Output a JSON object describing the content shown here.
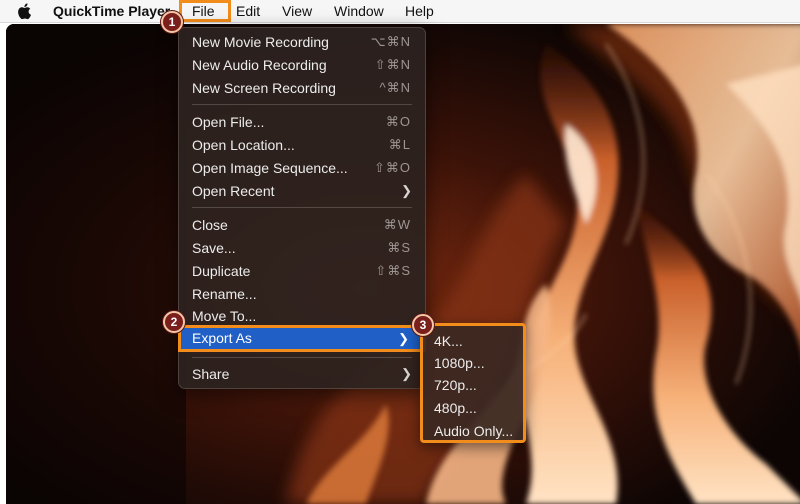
{
  "menubar": {
    "apple_icon": "apple-logo-icon",
    "app_name": "QuickTime Player",
    "items": [
      "File",
      "Edit",
      "View",
      "Window",
      "Help"
    ]
  },
  "file_menu": {
    "new_movie": {
      "label": "New Movie Recording",
      "shortcut": "⌥⌘N"
    },
    "new_audio": {
      "label": "New Audio Recording",
      "shortcut": "⇧⌘N"
    },
    "new_screen": {
      "label": "New Screen Recording",
      "shortcut": "^⌘N"
    },
    "open_file": {
      "label": "Open File...",
      "shortcut": "⌘O"
    },
    "open_location": {
      "label": "Open Location...",
      "shortcut": "⌘L"
    },
    "open_image_sequence": {
      "label": "Open Image Sequence...",
      "shortcut": "⇧⌘O"
    },
    "open_recent": {
      "label": "Open Recent"
    },
    "close": {
      "label": "Close",
      "shortcut": "⌘W"
    },
    "save": {
      "label": "Save...",
      "shortcut": "⌘S"
    },
    "duplicate": {
      "label": "Duplicate",
      "shortcut": "⇧⌘S"
    },
    "rename": {
      "label": "Rename..."
    },
    "move_to": {
      "label": "Move To..."
    },
    "export_as": {
      "label": "Export As"
    },
    "share": {
      "label": "Share"
    }
  },
  "export_submenu": {
    "items": [
      "4K...",
      "1080p...",
      "720p...",
      "480p...",
      "Audio Only..."
    ]
  },
  "annotations": {
    "step1": "1",
    "step2": "2",
    "step3": "3",
    "highlight_color": "#f28c1b"
  },
  "colors": {
    "selection": "#1f5fc6",
    "menu_bg": "#2c221f"
  }
}
